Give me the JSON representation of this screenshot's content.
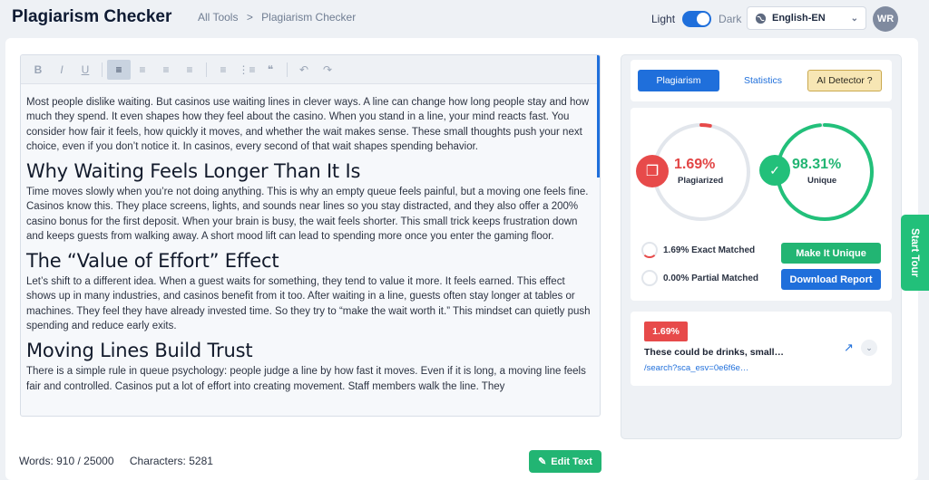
{
  "header": {
    "app_title": "Plagiarism Checker",
    "breadcrumbs": [
      "All Tools",
      ">",
      "Plagiarism Checker"
    ],
    "theme_light": "Light",
    "theme_dark": "Dark",
    "language": "English-EN",
    "avatar": "WR"
  },
  "editor": {
    "blocks": [
      {
        "type": "p",
        "text": "Most people dislike waiting. But casinos use waiting lines in clever ways. A line can change how long people stay and how much they spend. It even shapes how they feel about the casino. When you stand in a line, your mind reacts fast. You consider how fair it feels, how quickly it moves, and whether the wait makes sense. These small thoughts push your next choice, even if you don’t notice it. In casinos, every second of that wait shapes spending behavior."
      },
      {
        "type": "h2",
        "text": "Why Waiting Feels Longer Than It Is"
      },
      {
        "type": "p",
        "text": "Time moves slowly when you’re not doing anything. This is why an empty queue feels painful, but a moving one feels fine. Casinos know this. They place screens, lights, and sounds near lines so you stay distracted, and they also offer a 200% casino bonus for the first deposit. When your brain is busy, the wait feels shorter. This small trick keeps frustration down and keeps guests from walking away. A short mood lift can lead to spending more once you enter the gaming floor."
      },
      {
        "type": "h2",
        "text": "The “Value of Effort” Effect"
      },
      {
        "type": "p",
        "text": "Let’s shift to a different idea. When a guest waits for something, they tend to value it more. It feels earned. This effect shows up in many industries, and casinos benefit from it too. After waiting in a line, guests often stay longer at tables or machines. They feel they have already invested time. So they try to “make the wait worth it.” This mindset can quietly push spending and reduce early exits."
      },
      {
        "type": "h2",
        "text": "Moving Lines Build Trust"
      },
      {
        "type": "p",
        "text": "There is a simple rule in queue psychology: people judge a line by how fast it moves. Even if it is long, a moving line feels fair and controlled. Casinos put a lot of effort into creating movement. Staff members walk the line. They"
      }
    ],
    "toolbar": [
      "bold-icon",
      "italic-icon",
      "underline-icon",
      "align-left-icon",
      "align-center-icon",
      "align-right-icon",
      "align-justify-icon",
      "ordered-list-icon",
      "bullet-list-icon",
      "quote-icon",
      "undo-icon",
      "redo-icon"
    ]
  },
  "footer": {
    "words": "Words: 910 / 25000",
    "characters": "Characters: 5281",
    "edit_button": "Edit Text"
  },
  "panel": {
    "tabs": {
      "plagiarism": "Plagiarism",
      "statistics": "Statistics",
      "ai_detector": "AI Detector ?"
    },
    "plagiarized_pct": "1.69%",
    "plagiarized_label": "Plagiarized",
    "plagiarized_value": 1.69,
    "unique_pct": "98.31%",
    "unique_label": "Unique",
    "unique_value": 98.31,
    "exact_matched": "1.69% Exact Matched",
    "partial_matched": "0.00% Partial Matched",
    "make_unique": "Make It Unique",
    "download_report": "Download Report",
    "source": {
      "badge": "1.69%",
      "title": "These could be drinks, small…",
      "url": "/search?sca_esv=0e6f6e…"
    },
    "colors": {
      "red": "#e74a4a",
      "green": "#22c07a",
      "blue": "#1f6fdb"
    }
  },
  "start_tour": "Start Tour"
}
